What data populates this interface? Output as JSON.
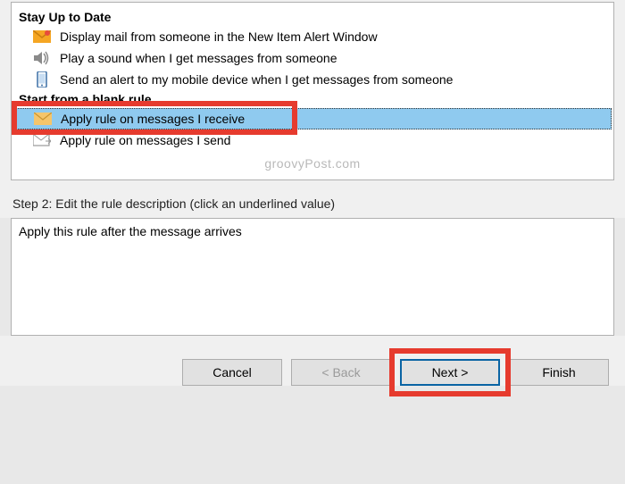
{
  "section_upToDate": {
    "header": "Stay Up to Date",
    "items": [
      {
        "label": "Display mail from someone in the New Item Alert Window"
      },
      {
        "label": "Play a sound when I get messages from someone"
      },
      {
        "label": "Send an alert to my mobile device when I get messages from someone"
      }
    ]
  },
  "section_blankRule": {
    "header": "Start from a blank rule",
    "items": [
      {
        "label": "Apply rule on messages I receive"
      },
      {
        "label": "Apply rule on messages I send"
      }
    ]
  },
  "watermark": "groovyPost.com",
  "step2Label": "Step 2: Edit the rule description (click an underlined value)",
  "ruleDescription": "Apply this rule after the message arrives",
  "buttons": {
    "cancel": "Cancel",
    "back": "< Back",
    "next": "Next >",
    "finish": "Finish"
  }
}
